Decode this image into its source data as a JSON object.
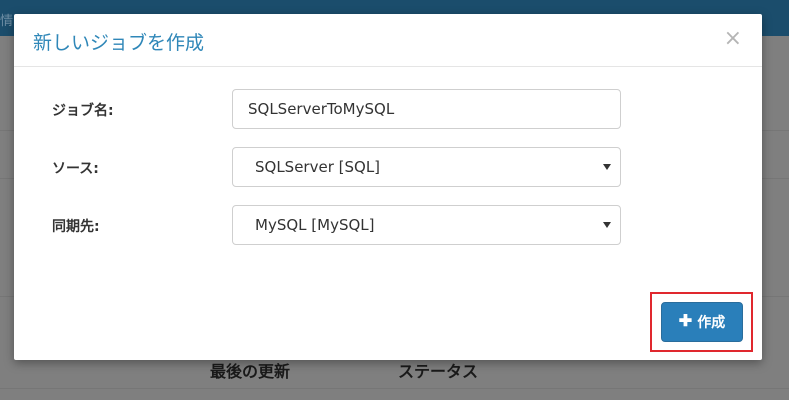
{
  "background": {
    "topbar_text": "情",
    "column_last_updated": "最後の更新",
    "column_status": "ステータス"
  },
  "modal": {
    "title": "新しいジョブを作成",
    "close_symbol": "×",
    "fields": {
      "job_name": {
        "label": "ジョブ名:",
        "value": "SQLServerToMySQL"
      },
      "source": {
        "label": "ソース:",
        "selected": "SQLServer [SQL]"
      },
      "destination": {
        "label": "同期先:",
        "selected": "MySQL [MySQL]"
      }
    },
    "create_button": {
      "icon": "plus-icon",
      "label": "作成"
    }
  },
  "colors": {
    "title": "#2f87b8",
    "primary_button": "#2a7fba",
    "highlight": "#e0282e"
  }
}
